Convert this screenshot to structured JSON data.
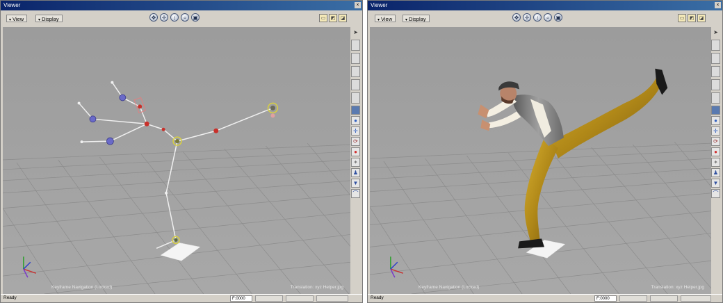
{
  "left": {
    "title": "Viewer",
    "menus": {
      "view": "View",
      "display": "Display"
    },
    "caption_left": "Keyframe Navigation (Locked)",
    "caption_right": "Translation: xyz  Helper.jpg",
    "status": "Ready",
    "frame": "F:0000"
  },
  "right": {
    "title": "Viewer",
    "menus": {
      "view": "View",
      "display": "Display"
    },
    "caption_left": "Keyframe Navigation (Locked)",
    "caption_right": "Translation: xyz  Helper.jpg",
    "status": "Ready",
    "frame": "F:0000"
  },
  "icons": {
    "nav": [
      "pan-icon",
      "orbit-icon",
      "dolly-icon",
      "zoom-icon",
      "fit-icon"
    ],
    "camera": [
      "camera-front-icon",
      "camera-persp-icon",
      "camera-side-icon"
    ]
  },
  "colors": {
    "viewport_bg": "#a0a0a0",
    "grid": "#8a8a8a",
    "bone": "#f0f0f0",
    "effector_red": "#c8302a",
    "effector_blue": "#6a6ac8",
    "effector_yellow": "#d8d040",
    "titlebar": "#0a246a",
    "pants": "#b8901a",
    "vest": "#7a7a7a"
  }
}
